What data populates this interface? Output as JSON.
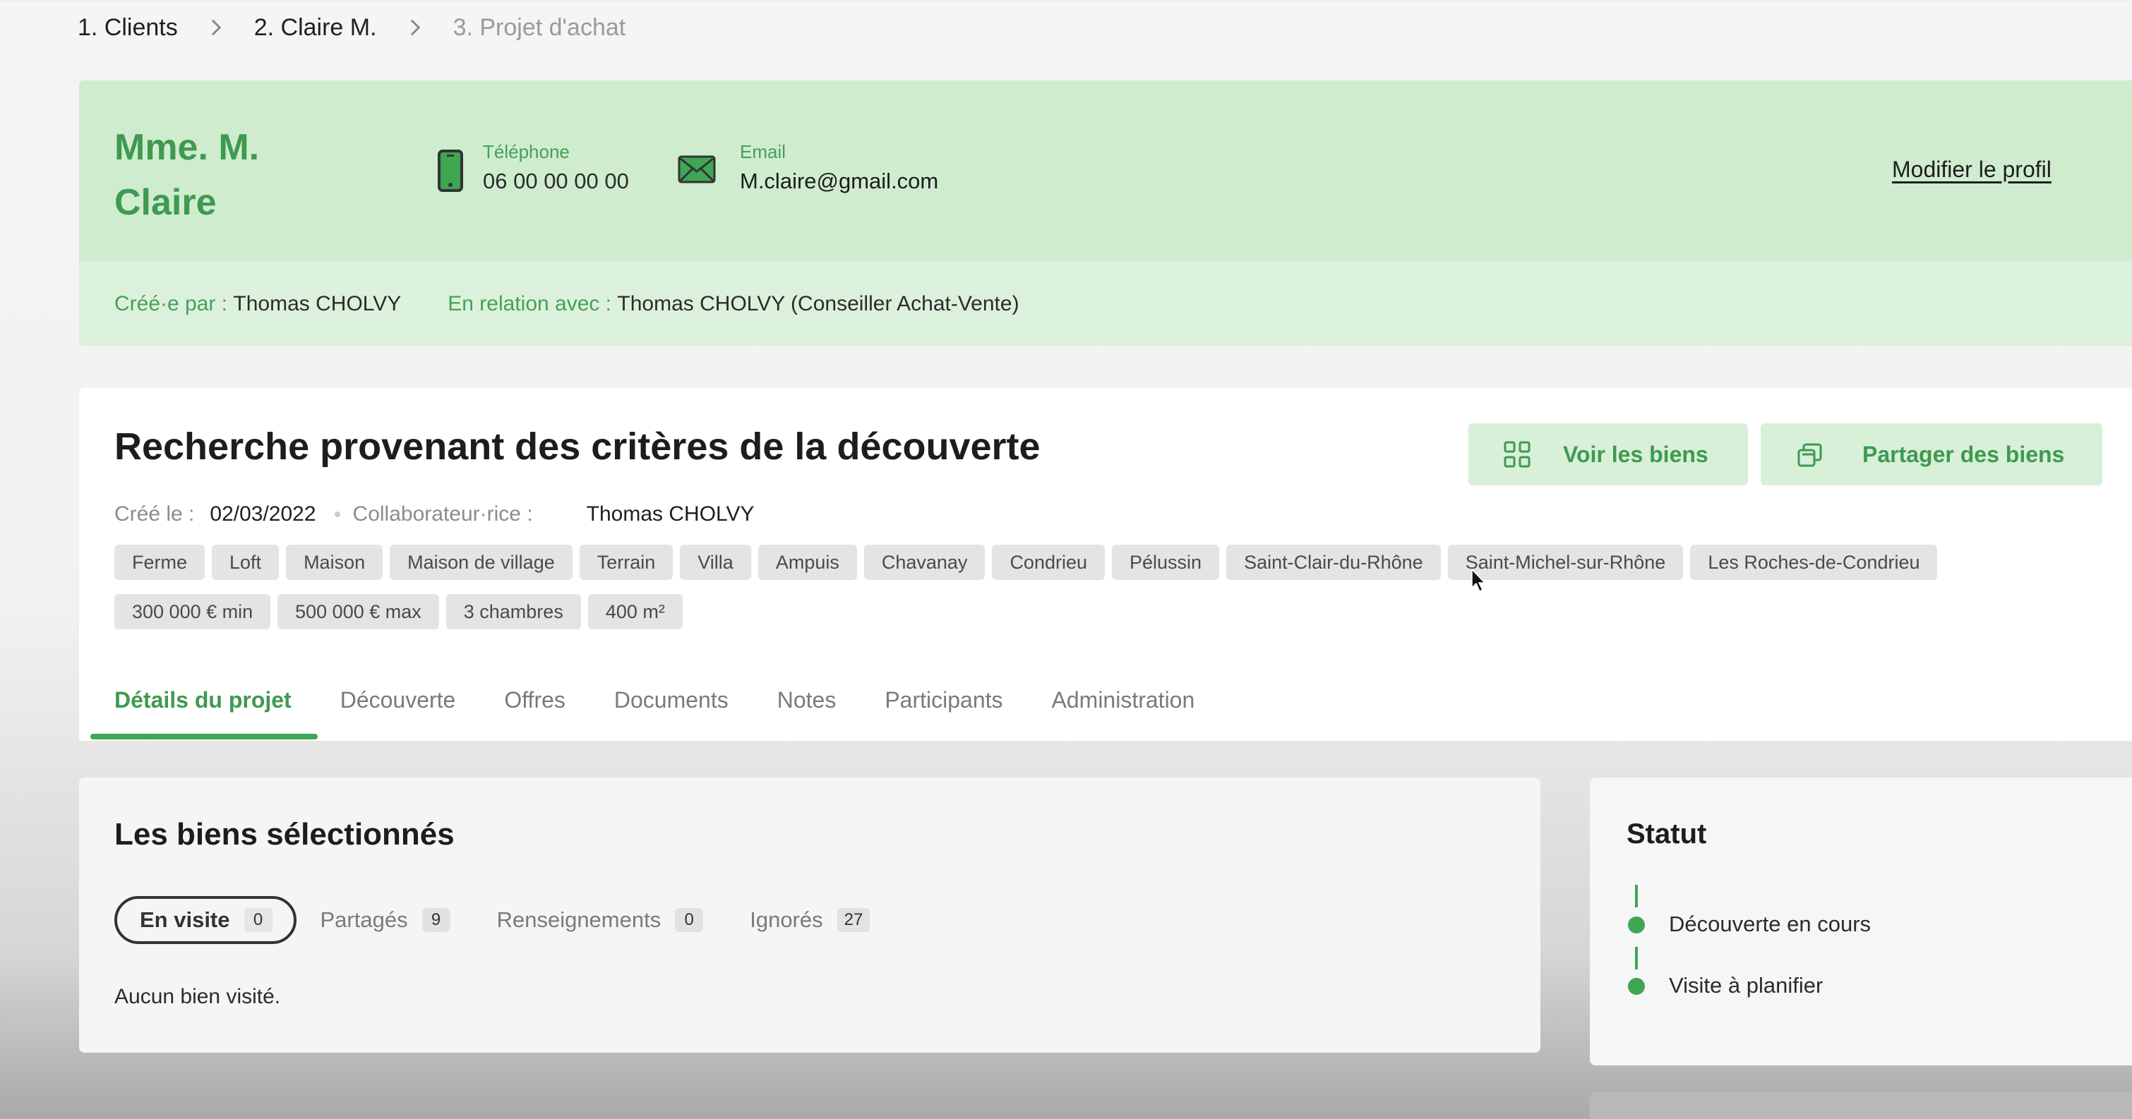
{
  "breadcrumb": [
    "1. Clients",
    "2. Claire M.",
    "3. Projet d'achat"
  ],
  "profile": {
    "name": "Mme. M. Claire",
    "phone_label": "Téléphone",
    "phone_value": "06 00 00 00 00",
    "email_label": "Email",
    "email_value": "M.claire@gmail.com",
    "edit_label": "Modifier le profil",
    "created_by_label": "Créé·e par :",
    "created_by_value": "Thomas CHOLVY",
    "relation_label": "En relation avec :",
    "relation_value": "Thomas CHOLVY (Conseiller Achat-Vente)"
  },
  "search": {
    "title": "Recherche provenant des critères de la découverte",
    "btn_voir": "Voir les biens",
    "btn_partager": "Partager des biens",
    "created_label": "Créé le :",
    "created_value": "02/03/2022",
    "collab_label": "Collaborateur·rice :",
    "collab_value": "Thomas CHOLVY",
    "tags": [
      "Ferme",
      "Loft",
      "Maison",
      "Maison de village",
      "Terrain",
      "Villa",
      "Ampuis",
      "Chavanay",
      "Condrieu",
      "Pélussin",
      "Saint-Clair-du-Rhône",
      "Saint-Michel-sur-Rhône",
      "Les Roches-de-Condrieu",
      "300 000 € min",
      "500 000 € max",
      "3 chambres",
      "400 m²"
    ]
  },
  "tabs": [
    "Détails du projet",
    "Découverte",
    "Offres",
    "Documents",
    "Notes",
    "Participants",
    "Administration"
  ],
  "biens": {
    "title": "Les biens sélectionnés",
    "filters": [
      {
        "label": "En visite",
        "count": "0"
      },
      {
        "label": "Partagés",
        "count": "9"
      },
      {
        "label": "Renseignements",
        "count": "0"
      },
      {
        "label": "Ignorés",
        "count": "27"
      }
    ],
    "empty": "Aucun bien visité."
  },
  "statut": {
    "title": "Statut",
    "steps": [
      "Découverte en cours",
      "Visite à planifier"
    ]
  },
  "colors": {
    "accent": "#3fa654",
    "profile_bg": "#cfeccf"
  }
}
